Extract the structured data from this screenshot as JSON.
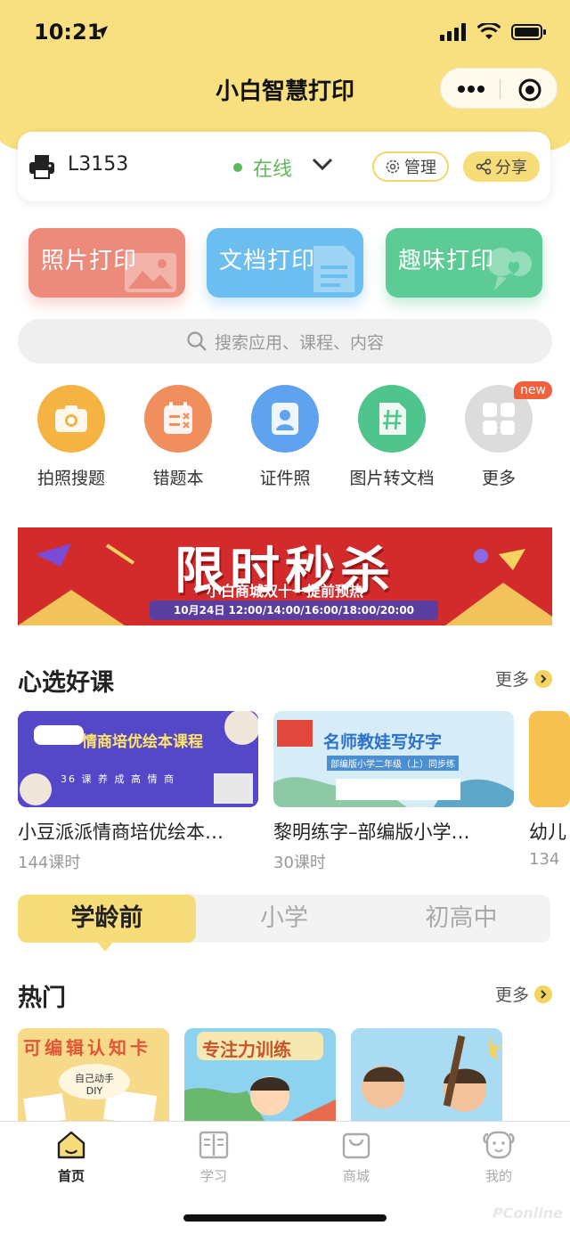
{
  "status_bar": {
    "time": "10:21"
  },
  "header": {
    "title": "小白智慧打印"
  },
  "device": {
    "name": "L3153",
    "status": "在线",
    "manage_label": "管理",
    "share_label": "分享"
  },
  "print_buttons": [
    {
      "label": "照片打印",
      "color": "#ec8a7c"
    },
    {
      "label": "文档打印",
      "color": "#6cbdf0"
    },
    {
      "label": "趣味打印",
      "color": "#5ccb95"
    }
  ],
  "search": {
    "placeholder": "搜索应用、课程、内容"
  },
  "apps": [
    {
      "label": "拍照搜题",
      "icon": "camera-icon",
      "color": "#f5b343"
    },
    {
      "label": "错题本",
      "icon": "notebook-icon",
      "color": "#f08e5e"
    },
    {
      "label": "证件照",
      "icon": "id-photo-icon",
      "color": "#5fa3ef"
    },
    {
      "label": "图片转文档",
      "icon": "image-to-doc-icon",
      "color": "#4fc48c"
    },
    {
      "label": "更多",
      "icon": "grid-icon",
      "color": "#dcdcdc",
      "badge": "new"
    }
  ],
  "banner": {
    "headline": "限时秒杀",
    "subline": "小白商城双十一提前预热",
    "schedule": "10月24日 12:00/14:00/16:00/18:00/20:00"
  },
  "courses_section": {
    "title": "心选好课",
    "more_label": "更多",
    "items": [
      {
        "title": "小豆派派情商培优绘本…",
        "meta": "144课时",
        "banner_text": "情商培优绘本课程",
        "banner_tag": "36 课 养 成 高 情 商"
      },
      {
        "title": "黎明练字–部编版小学…",
        "meta": "30课时",
        "banner_text": "名师教娃写好字",
        "banner_tag": "部编版小学二年级（上）同步练"
      },
      {
        "title": "幼儿",
        "meta": "134"
      }
    ]
  },
  "age_tabs": [
    "学龄前",
    "小学",
    "初高中"
  ],
  "hot_section": {
    "title": "热门",
    "more_label": "更多",
    "items": [
      {
        "caption": "可编辑认知卡",
        "sub": "自己动手 DIY",
        "color": "#f6d37e"
      },
      {
        "caption": "专注力训练",
        "color": "#8ad1f0"
      },
      {
        "caption": "",
        "color": "#9fd6ef"
      }
    ]
  },
  "tabbar": [
    {
      "label": "首页",
      "icon": "home-icon",
      "active": true
    },
    {
      "label": "学习",
      "icon": "book-icon",
      "active": false
    },
    {
      "label": "商城",
      "icon": "bag-icon",
      "active": false
    },
    {
      "label": "我的",
      "icon": "profile-icon",
      "active": false
    }
  ],
  "watermark": "PConline"
}
